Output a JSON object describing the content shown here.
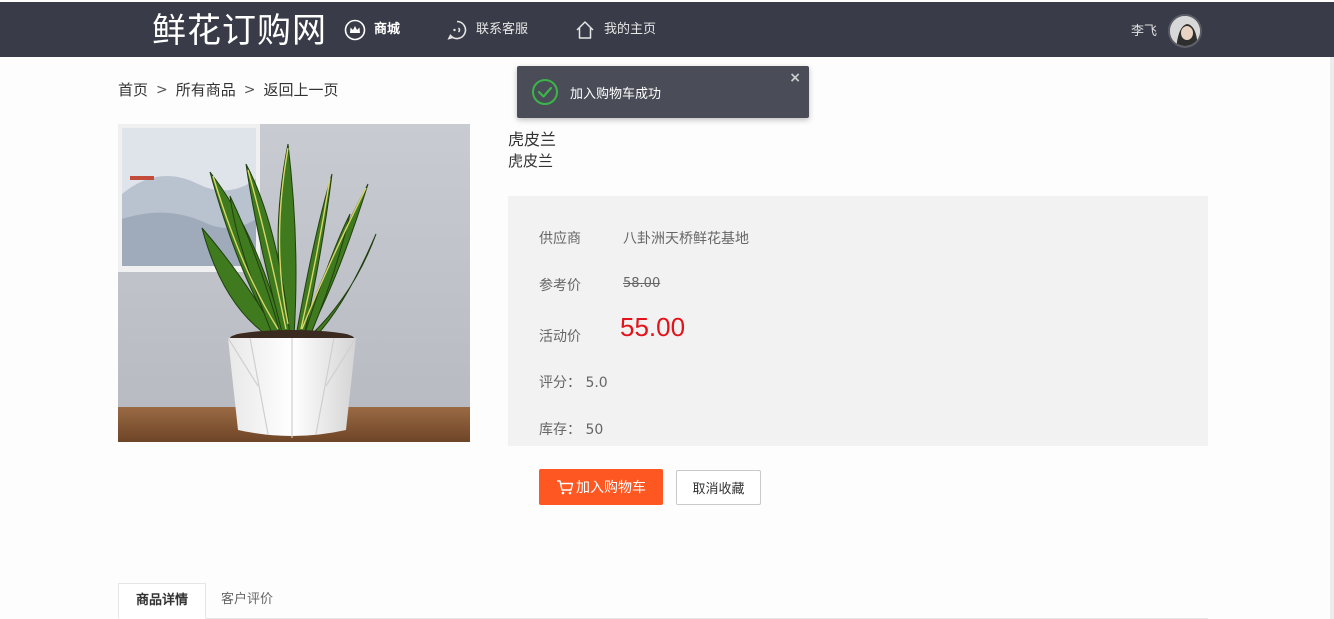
{
  "header": {
    "logo": "鲜花订购网",
    "nav": {
      "shop": "商城",
      "service": "联系客服",
      "home": "我的主页"
    },
    "user_name": "李飞"
  },
  "breadcrumb": {
    "home": "首页",
    "all": "所有商品",
    "back": "返回上一页",
    "separator": ">"
  },
  "toast": {
    "message": "加入购物车成功",
    "close": "×"
  },
  "product": {
    "name": "虎皮兰",
    "subtitle": "虎皮兰",
    "supplier_label": "供应商",
    "supplier": "八卦洲天桥鲜花基地",
    "ref_price_label": "参考价",
    "ref_price": "58.00",
    "act_price_label": "活动价",
    "act_price": "55.00",
    "rating": "评分： 5.0",
    "stock": "库存： 50"
  },
  "actions": {
    "add_to_cart": "加入购物车",
    "unfavorite": "取消收藏"
  },
  "tabs": [
    "商品详情",
    "客户评价"
  ],
  "colors": {
    "header_bg": "#393c48",
    "accent": "#ff5722",
    "price": "#e4121a",
    "toast_bg": "#4a4d57",
    "success": "#3bb54a"
  },
  "icons": [
    "crown-icon",
    "chat-icon",
    "home-icon",
    "cart-icon",
    "check-circle-icon",
    "close-icon"
  ]
}
